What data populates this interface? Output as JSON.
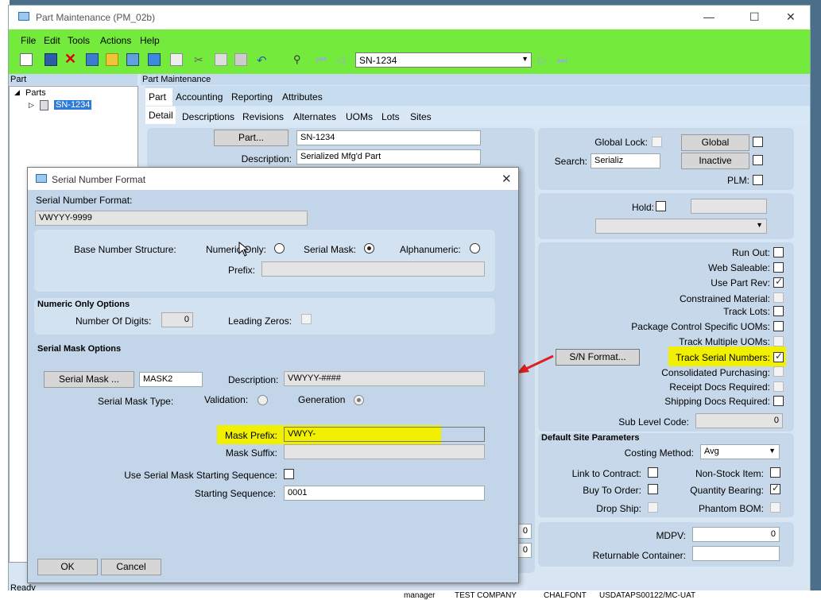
{
  "window": {
    "title": "Part Maintenance (PM_02b)",
    "minimize": "—",
    "maximize": "☐",
    "close": "✕"
  },
  "menu": {
    "file": "File",
    "edit": "Edit",
    "tools": "Tools",
    "actions": "Actions",
    "help": "Help"
  },
  "toolbar": {
    "part_value": "SN-1234"
  },
  "left_panel": {
    "header": "Part",
    "tree_root": "Parts",
    "tree_item": "SN-1234"
  },
  "main_panel": {
    "header": "Part Maintenance"
  },
  "tabs_top": [
    "Part",
    "Accounting",
    "Reporting",
    "Attributes"
  ],
  "tabs_sub": [
    "Detail",
    "Descriptions",
    "Revisions",
    "Alternates",
    "UOMs",
    "Lots",
    "Sites"
  ],
  "part": {
    "button": "Part...",
    "value": "SN-1234",
    "desc_label": "Description:",
    "desc_value": "Serialized Mfg'd Part"
  },
  "global": {
    "lock_label": "Global Lock:",
    "search_label": "Search:",
    "search_value": "Serializ",
    "plm_label": "PLM:",
    "global_btn": "Global",
    "inactive_btn": "Inactive"
  },
  "hold": {
    "label": "Hold:"
  },
  "flags": [
    {
      "label": "Run Out:",
      "checked": false,
      "enabled": true
    },
    {
      "label": "Web Saleable:",
      "checked": false,
      "enabled": true
    },
    {
      "label": "Use Part Rev:",
      "checked": true,
      "enabled": true
    },
    {
      "label": "Constrained Material:",
      "checked": false,
      "enabled": false
    },
    {
      "label": "Track Lots:",
      "checked": false,
      "enabled": true
    },
    {
      "label": "Package Control Specific UOMs:",
      "checked": false,
      "enabled": true
    },
    {
      "label": "Track Multiple UOMs:",
      "checked": false,
      "enabled": false
    },
    {
      "label": "Track Serial Numbers:",
      "checked": true,
      "enabled": true
    },
    {
      "label": "Consolidated Purchasing:",
      "checked": false,
      "enabled": false
    },
    {
      "label": "Receipt Docs Required:",
      "checked": false,
      "enabled": false
    },
    {
      "label": "Shipping Docs Required:",
      "checked": false,
      "enabled": true
    }
  ],
  "sn_format_btn": "S/N Format...",
  "sub_level": {
    "label": "Sub Level Code:",
    "value": "0"
  },
  "site": {
    "title": "Default Site Parameters",
    "costing_label": "Costing Method:",
    "costing_value": "Avg",
    "link_contract": "Link to Contract:",
    "buy_to_order": "Buy To Order:",
    "drop_ship": "Drop Ship:",
    "non_stock": "Non-Stock Item:",
    "qty_bearing": "Quantity Bearing:",
    "phantom_bom": "Phantom BOM:"
  },
  "mdpv": {
    "label": "MDPV:",
    "value": "0",
    "returnable_label": "Returnable Container:"
  },
  "hidden_zero1": "0",
  "hidden_zero2": "0",
  "dialog": {
    "title": "Serial Number Format",
    "format_label": "Serial Number Format:",
    "format_value": "VWYYY-9999",
    "base_label": "Base Number Structure:",
    "numeric_only": "Numeric Only:",
    "serial_mask": "Serial Mask:",
    "alphanumeric": "Alphanumeric:",
    "prefix_label": "Prefix:",
    "numeric_options_title": "Numeric Only Options",
    "digits_label": "Number Of Digits:",
    "digits_value": "0",
    "leading_zeros": "Leading Zeros:",
    "mask_options_title": "Serial Mask Options",
    "mask_btn": "Serial Mask ...",
    "mask_value": "MASK2",
    "mask_desc_label": "Description:",
    "mask_desc_value": "VWYYY-####",
    "mask_type_label": "Serial Mask Type:",
    "validation": "Validation:",
    "generation": "Generation",
    "mask_prefix_label": "Mask Prefix:",
    "mask_prefix_value": "VWYY-",
    "mask_suffix_label": "Mask Suffix:",
    "use_start_label": "Use Serial Mask Starting Sequence:",
    "start_seq_label": "Starting Sequence:",
    "start_seq_value": "0001",
    "ok": "OK",
    "cancel": "Cancel"
  },
  "status": {
    "ready": "Ready",
    "user": "manager",
    "company": "TEST COMPANY",
    "plant": "CHALFONT",
    "server": "USDATAPS00122/MC-UAT"
  },
  "colors": {
    "menubar": "#74ea3c",
    "highlight": "#f0f000",
    "arrow": "#e02020"
  }
}
